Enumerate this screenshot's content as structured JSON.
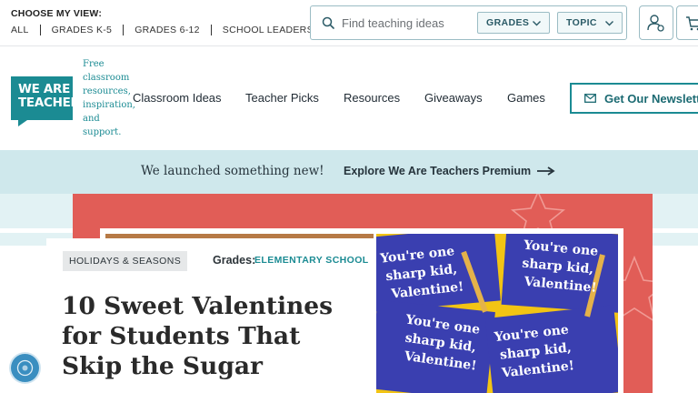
{
  "topbar": {
    "view_title": "CHOOSE MY VIEW:",
    "view_links": [
      "ALL",
      "GRADES K-5",
      "GRADES 6-12",
      "SCHOOL LEADERS"
    ],
    "search_placeholder": "Find teaching ideas",
    "filter_grades": "GRADES",
    "filter_topic": "TOPIC"
  },
  "brand": {
    "logo_line1": "WE ARE",
    "logo_line2": "TEACHERS",
    "tagline": "Free classroom resources, inspiration, and support.",
    "color": "#1b8b93"
  },
  "nav": {
    "items": [
      "Classroom Ideas",
      "Teacher Picks",
      "Resources",
      "Giveaways",
      "Games"
    ],
    "newsletter_label": "Get Our Newsletter"
  },
  "banner": {
    "text": "We launched something new!",
    "link": "Explore We Are Teachers Premium"
  },
  "hero": {
    "tag": "HOLIDAYS & SEASONS",
    "grades_label": "Grades:",
    "grades_value": "ELEMENTARY SCHOOL",
    "headline": "10 Sweet Valentines for Students That Skip the Sugar",
    "card_text": [
      "You're one sharp kid, Valentine!",
      "You're one sharp kid, Valentine!",
      "You're one sharp kid, Valentine!",
      "You're one sharp kid, Valentine!"
    ]
  },
  "icons": {
    "search": "search-icon",
    "chevron": "chevron-down-icon",
    "user": "user-settings-icon",
    "cart": "cart-icon",
    "mail": "mail-icon",
    "arrow": "arrow-right-icon",
    "help": "help-icon"
  }
}
